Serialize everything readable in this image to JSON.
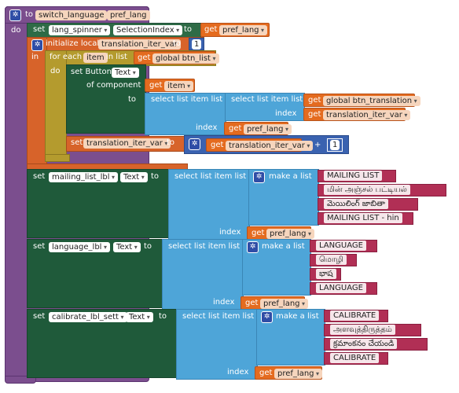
{
  "proc": {
    "to": "to",
    "name": "switch_language",
    "param": "pref_lang",
    "do": "do"
  },
  "spinner": {
    "set": "set",
    "component": "lang_spinner",
    "dot": ".",
    "prop": "SelectionIndex",
    "to": "to",
    "get": "get",
    "var": "pref_lang"
  },
  "local": {
    "init": "initialize local",
    "name": "translation_iter_var",
    "to": "to",
    "value": "1",
    "in": "in"
  },
  "foreach": {
    "label": "for each",
    "item": "item",
    "in_list": "in list",
    "get": "get",
    "var": "global btn_list",
    "do": "do"
  },
  "setbutton": {
    "label": "set Button.",
    "prop": "Text",
    "of_component": "of component",
    "get": "get",
    "item": "item",
    "to": "to"
  },
  "sli1": {
    "outer": "select list item  list",
    "inner": "select list item  list",
    "get": "get",
    "global": "global btn_translation",
    "index": "index",
    "iter": "translation_iter_var",
    "outer_index": "index",
    "pref": "pref_lang"
  },
  "setiter": {
    "set": "set",
    "var": "translation_iter_var",
    "to": "to",
    "get": "get",
    "iter": "translation_iter_var",
    "plus": "+",
    "one": "1"
  },
  "mailing": {
    "set": "set",
    "component": "mailing_list_lbl",
    "dot": ".",
    "prop": "Text",
    "to": "to",
    "select": "select list item  list",
    "make": "make a list",
    "items": [
      "MAILING LIST",
      "மின் அஞ்சல் பட்டியல்",
      "మెయిలింగ్ జాబితా",
      "MAILING LIST - hin"
    ],
    "index": "index",
    "get": "get",
    "pref": "pref_lang"
  },
  "language": {
    "set": "set",
    "component": "language_lbl",
    "dot": ".",
    "prop": "Text",
    "to": "to",
    "select": "select list item  list",
    "make": "make a list",
    "items": [
      "LANGUAGE",
      "மொழி",
      "భాష",
      "LANGUAGE"
    ],
    "index": "index",
    "get": "get",
    "pref": "pref_lang"
  },
  "calibrate": {
    "set": "set",
    "component": "calibrate_lbl_sett",
    "dot": ".",
    "prop": "Text",
    "to": "to",
    "select": "select list item  list",
    "make": "make a list",
    "items": [
      "CALIBRATE",
      "அளவுத்திருத்தம்",
      "క్రమాంకనం చేయండి",
      "CALIBRATE"
    ],
    "index": "index",
    "get": "get",
    "pref": "pref_lang"
  },
  "icons": {
    "mutator": "gear-icon"
  },
  "colors": {
    "procedure": "#7b4e8e",
    "component_set": "#2e6b46",
    "list": "#4ea5d8",
    "variable_get": "#e46b1f",
    "loop": "#b49b2e",
    "text": "#b12f55",
    "math": "#3a62b0"
  }
}
